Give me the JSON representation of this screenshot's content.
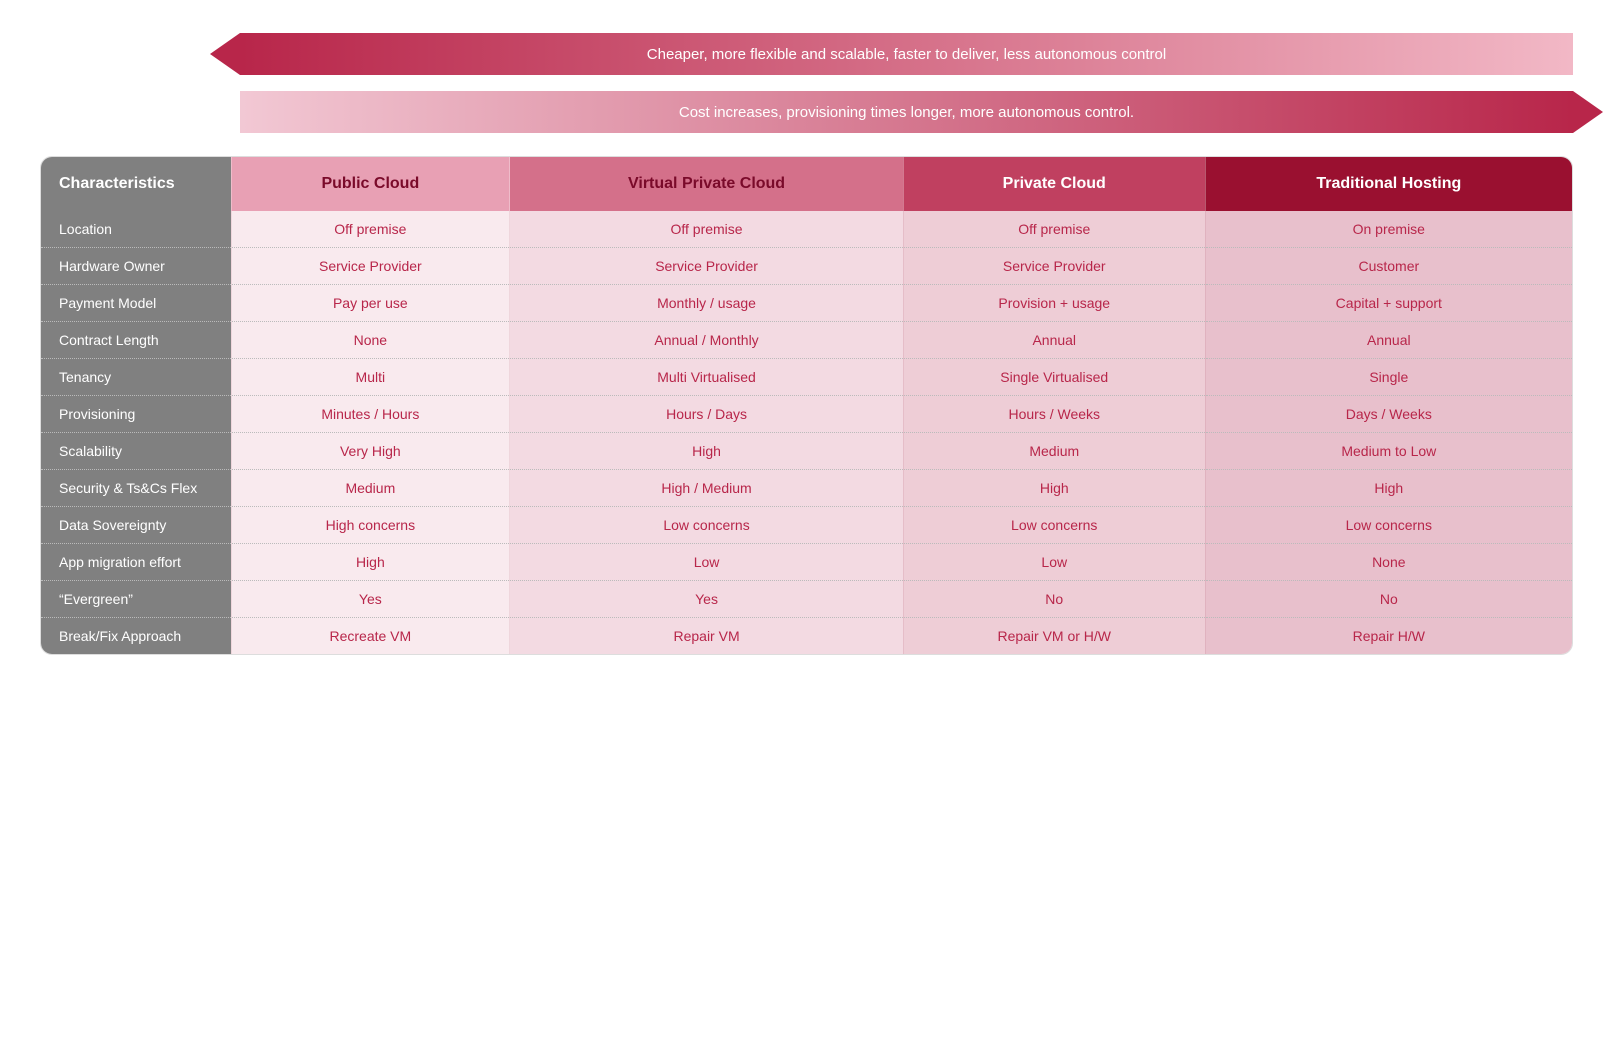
{
  "arrows": {
    "top": {
      "text": "Cheaper, more flexible and scalable, faster to deliver, less autonomous control",
      "direction": "left"
    },
    "bottom": {
      "text": "Cost increases, provisioning times longer, more autonomous control.",
      "direction": "right"
    }
  },
  "table": {
    "headers": {
      "characteristics": "Characteristics",
      "col1": "Public Cloud",
      "col2": "Virtual Private Cloud",
      "col3": "Private Cloud",
      "col4": "Traditional Hosting"
    },
    "rows": [
      {
        "char": "Location",
        "col1": "Off premise",
        "col2": "Off premise",
        "col3": "Off premise",
        "col4": "On premise"
      },
      {
        "char": "Hardware Owner",
        "col1": "Service Provider",
        "col2": "Service Provider",
        "col3": "Service Provider",
        "col4": "Customer"
      },
      {
        "char": "Payment Model",
        "col1": "Pay per use",
        "col2": "Monthly / usage",
        "col3": "Provision + usage",
        "col4": "Capital + support"
      },
      {
        "char": "Contract Length",
        "col1": "None",
        "col2": "Annual / Monthly",
        "col3": "Annual",
        "col4": "Annual"
      },
      {
        "char": "Tenancy",
        "col1": "Multi",
        "col2": "Multi Virtualised",
        "col3": "Single Virtualised",
        "col4": "Single"
      },
      {
        "char": "Provisioning",
        "col1": "Minutes / Hours",
        "col2": "Hours / Days",
        "col3": "Hours / Weeks",
        "col4": "Days / Weeks"
      },
      {
        "char": "Scalability",
        "col1": "Very High",
        "col2": "High",
        "col3": "Medium",
        "col4": "Medium to Low"
      },
      {
        "char": "Security & Ts&Cs Flex",
        "col1": "Medium",
        "col2": "High / Medium",
        "col3": "High",
        "col4": "High"
      },
      {
        "char": "Data Sovereignty",
        "col1": "High concerns",
        "col2": "Low concerns",
        "col3": "Low concerns",
        "col4": "Low concerns"
      },
      {
        "char": "App migration effort",
        "col1": "High",
        "col2": "Low",
        "col3": "Low",
        "col4": "None"
      },
      {
        "char": "“Evergreen”",
        "col1": "Yes",
        "col2": "Yes",
        "col3": "No",
        "col4": "No"
      },
      {
        "char": "Break/Fix Approach",
        "col1": "Recreate VM",
        "col2": "Repair VM",
        "col3": "Repair VM or H/W",
        "col4": "Repair H/W"
      }
    ]
  }
}
